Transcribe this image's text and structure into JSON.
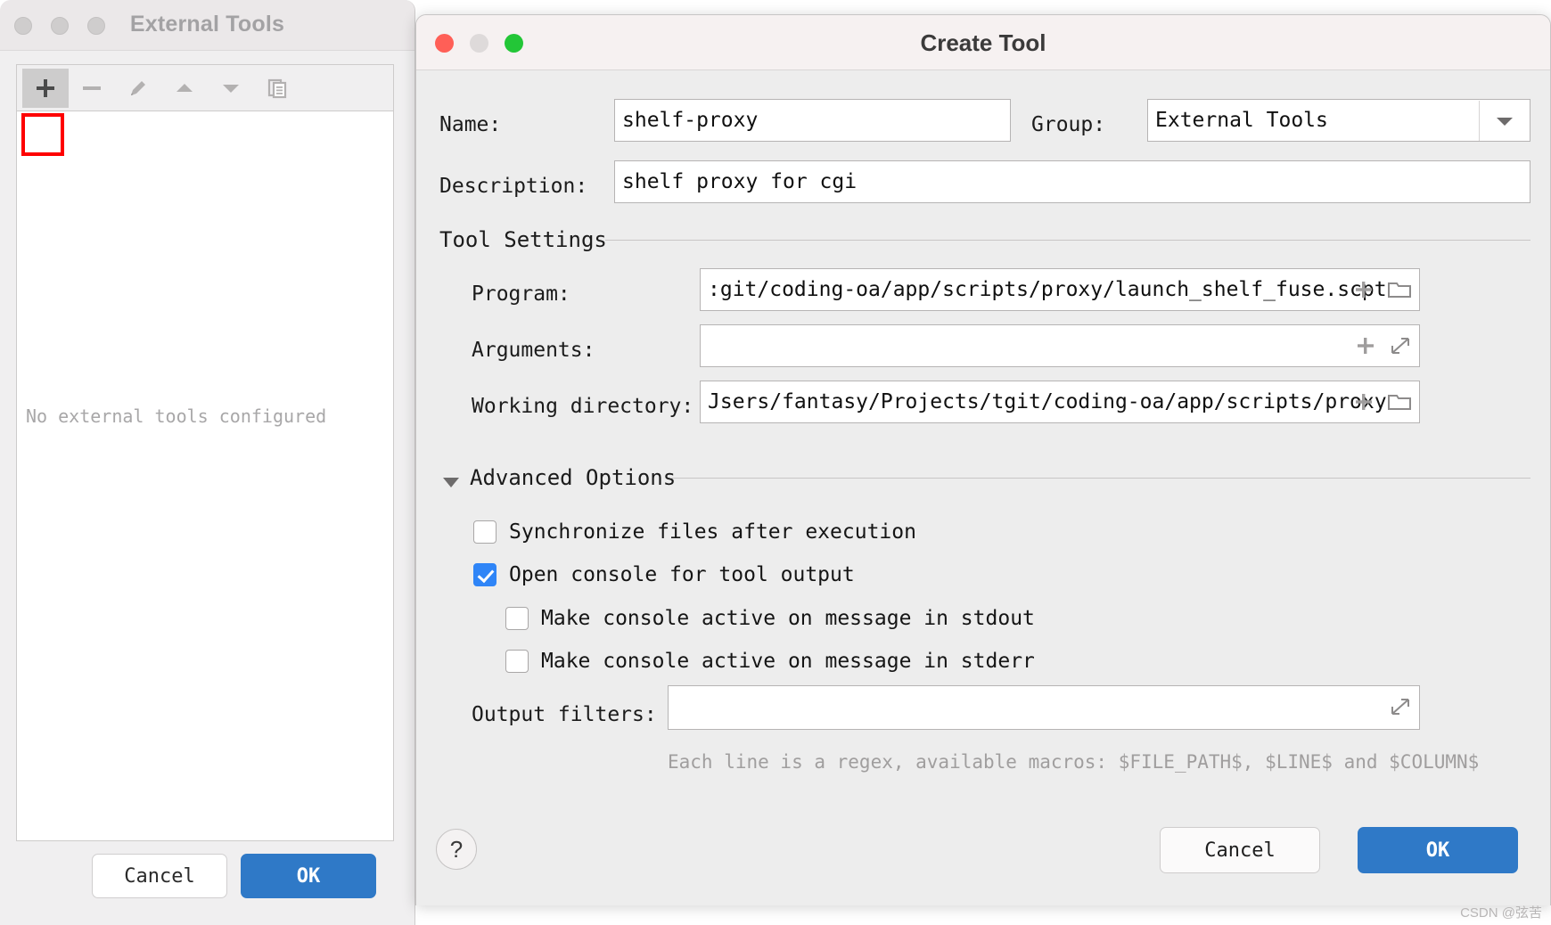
{
  "external_tools_window": {
    "title": "External Tools",
    "traffic_lights": [
      "close",
      "minimize",
      "maximize"
    ],
    "toolbar": [
      {
        "name": "add",
        "icon": "plus-icon",
        "highlighted": true
      },
      {
        "name": "remove",
        "icon": "minus-icon",
        "highlighted": false
      },
      {
        "name": "edit",
        "icon": "pencil-icon",
        "highlighted": false
      },
      {
        "name": "move-up",
        "icon": "triangle-up-icon",
        "highlighted": false
      },
      {
        "name": "move-down",
        "icon": "triangle-down-icon",
        "highlighted": false
      },
      {
        "name": "copy",
        "icon": "copy-icon",
        "highlighted": false
      }
    ],
    "empty_message": "No external tools configured",
    "cancel_label": "Cancel",
    "ok_label": "OK"
  },
  "create_tool_window": {
    "title": "Create Tool",
    "name": {
      "label": "Name:",
      "value": "shelf-proxy",
      "placeholder": ""
    },
    "group": {
      "label": "Group:",
      "value": "External Tools",
      "arrow_icon": "chevron-down-icon"
    },
    "description": {
      "label": "Description:",
      "value": "shelf proxy for cgi",
      "placeholder": ""
    },
    "tool_settings": {
      "section_label": "Tool Settings",
      "program": {
        "label": "Program:",
        "value": ":git/coding-oa/app/scripts/proxy/launch_shelf_fuse.scpt",
        "icons": [
          "insert-macro-icon",
          "browse-folder-icon"
        ]
      },
      "arguments": {
        "label": "Arguments:",
        "value": "",
        "icons": [
          "insert-macro-icon",
          "expand-icon"
        ]
      },
      "working_directory": {
        "label": "Working directory:",
        "value": "Jsers/fantasy/Projects/tgit/coding-oa/app/scripts/proxy",
        "icons": [
          "insert-macro-icon",
          "browse-folder-icon"
        ]
      }
    },
    "advanced_options": {
      "section_label": "Advanced Options",
      "expanded": true,
      "checkboxes": [
        {
          "label": "Synchronize files after execution",
          "checked": false
        },
        {
          "label": "Open console for tool output",
          "checked": true
        },
        {
          "label": "Make console active on message in stdout",
          "checked": false
        },
        {
          "label": "Make console active on message in stderr",
          "checked": false
        }
      ],
      "output_filters": {
        "label": "Output filters:",
        "value": "",
        "icon": "expand-icon",
        "hint": "Each line is a regex, available macros: $FILE_PATH$, $LINE$ and $COLUMN$"
      }
    },
    "help_label": "?",
    "cancel_label": "Cancel",
    "ok_label": "OK"
  },
  "watermark": "CSDN @弦苦",
  "colors": {
    "accent_blue": "#2f79c7",
    "checkbox_blue": "#2f85f7",
    "highlight_red": "#fe0000",
    "close_red": "#ff5f57",
    "maximize_green": "#23c637"
  }
}
